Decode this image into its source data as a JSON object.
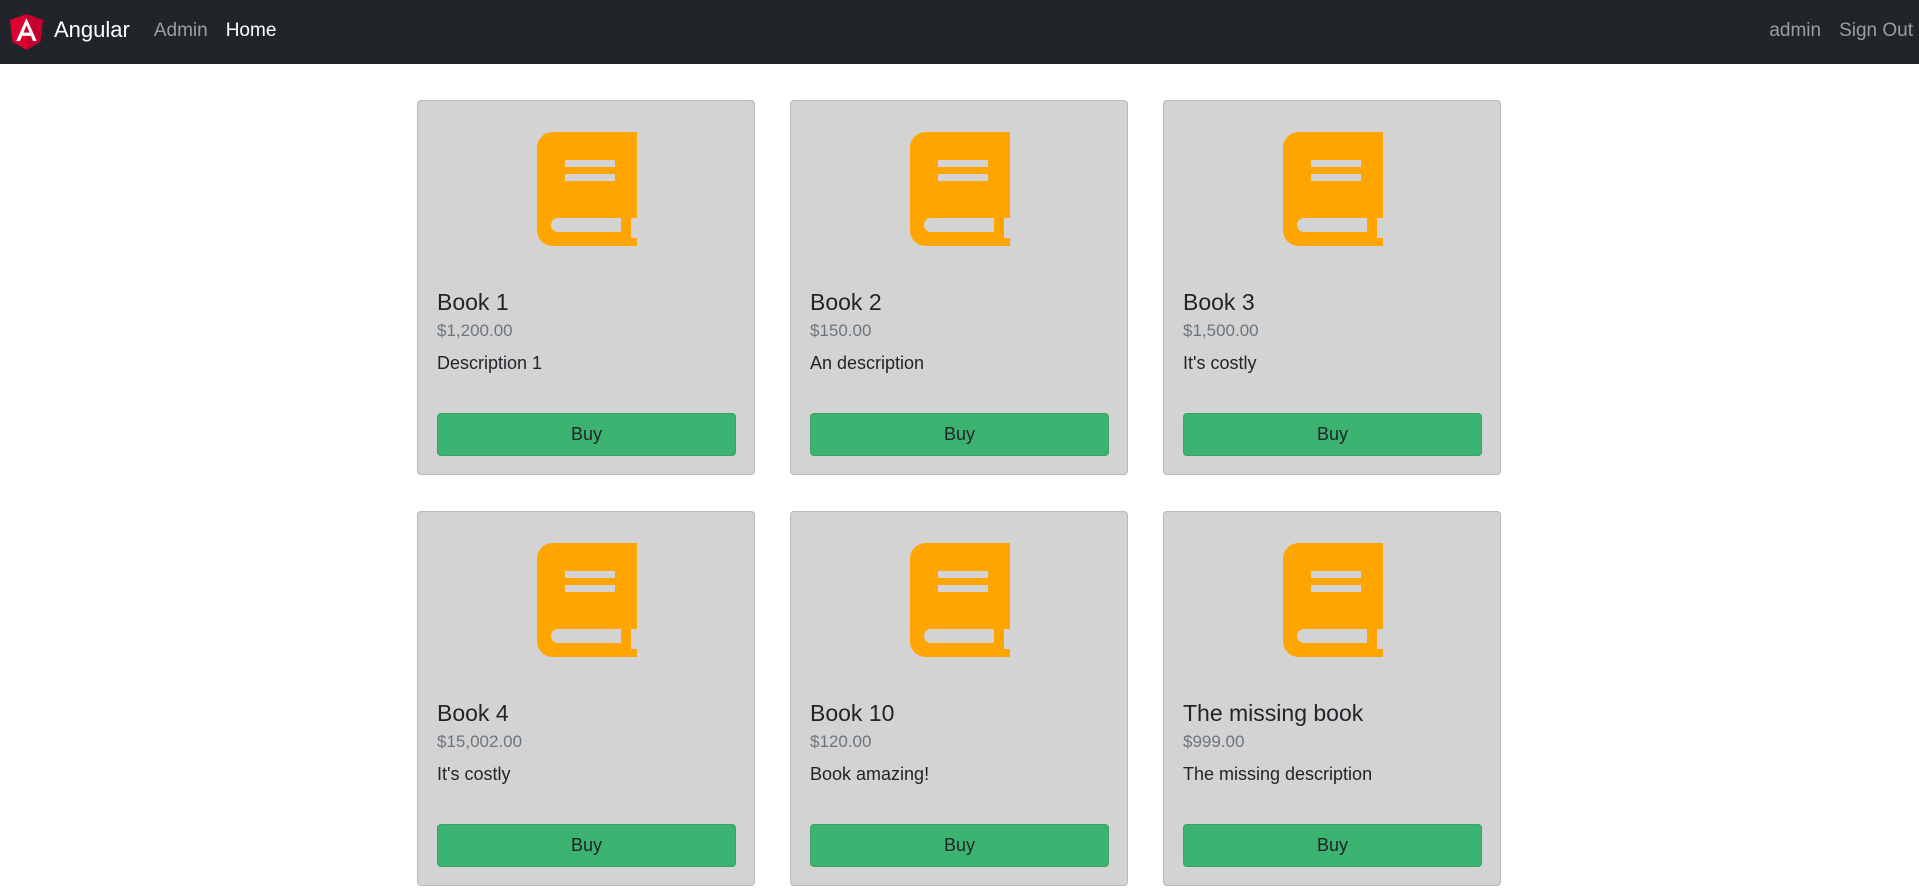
{
  "navbar": {
    "brand": "Angular",
    "links": [
      {
        "label": "Admin"
      },
      {
        "label": "Home"
      }
    ],
    "user": "admin",
    "signout": "Sign Out"
  },
  "books": [
    {
      "title": "Book 1",
      "price": "$1,200.00",
      "description": "Description 1",
      "button": "Buy"
    },
    {
      "title": "Book 2",
      "price": "$150.00",
      "description": "An description",
      "button": "Buy"
    },
    {
      "title": "Book 3",
      "price": "$1,500.00",
      "description": "It's costly",
      "button": "Buy"
    },
    {
      "title": "Book 4",
      "price": "$15,002.00",
      "description": "It's costly",
      "button": "Buy"
    },
    {
      "title": "Book 10",
      "price": "$120.00",
      "description": "Book amazing!",
      "button": "Buy"
    },
    {
      "title": "The missing book",
      "price": "$999.00",
      "description": "The missing description",
      "button": "Buy"
    }
  ],
  "colors": {
    "navbar": "#212529",
    "card": "#d3d3d3",
    "book_icon": "#ffa500",
    "buy_button": "#3cb371",
    "angular_logo": "#dd0031"
  },
  "icons": {
    "brand": "angular-logo-icon",
    "card": "book-icon"
  }
}
